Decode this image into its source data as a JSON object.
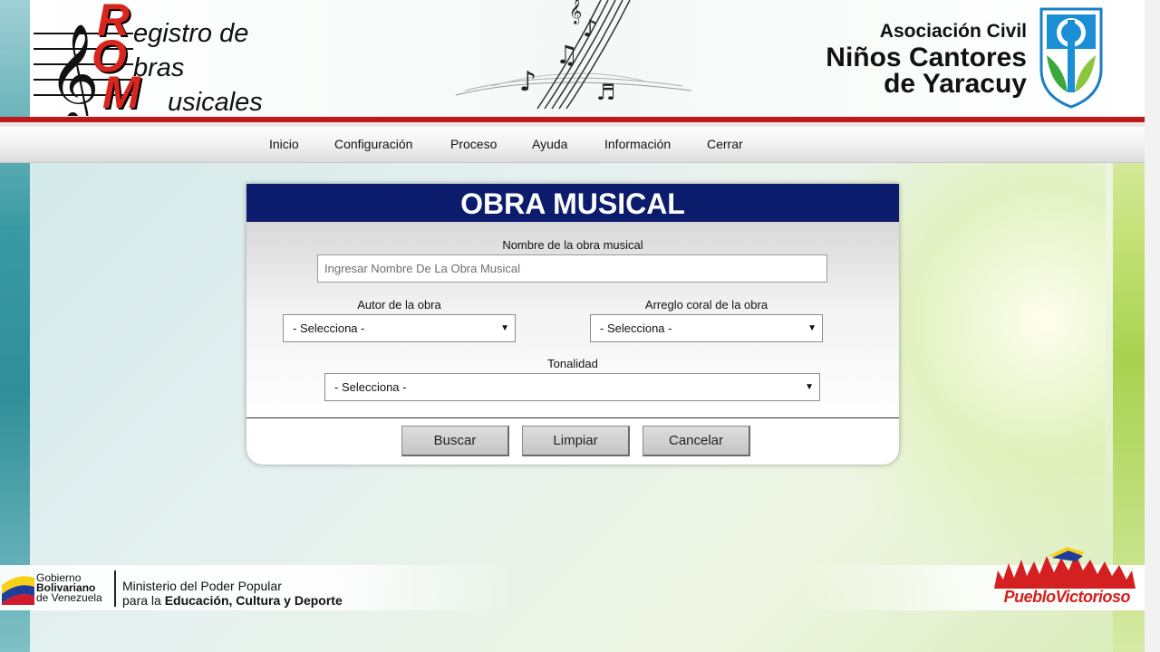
{
  "header": {
    "rom_letters": [
      "R",
      "O",
      "M"
    ],
    "rom_words": [
      "egistro de",
      "bras",
      "usicales"
    ],
    "assoc_line1": "Asociación Civil",
    "assoc_line2": "Niños Cantores",
    "assoc_line3": "de Yaracuy"
  },
  "nav": {
    "items": [
      "Inicio",
      "Configuración",
      "Proceso",
      "Ayuda",
      "Información",
      "Cerrar"
    ]
  },
  "form": {
    "title": "OBRA MUSICAL",
    "nombre_label": "Nombre de la obra musical",
    "nombre_placeholder": "Ingresar Nombre De La Obra Musical",
    "autor_label": "Autor de la obra",
    "autor_value": "- Selecciona -",
    "arreglo_label": "Arreglo coral de la obra",
    "arreglo_value": "- Selecciona -",
    "tonalidad_label": "Tonalidad",
    "tonalidad_value": "- Selecciona -",
    "buttons": {
      "buscar": "Buscar",
      "limpiar": "Limpiar",
      "cancelar": "Cancelar"
    }
  },
  "footer": {
    "gob_line1": "Gobierno",
    "gob_line2": "Bolivariano",
    "gob_line3": "de Venezuela",
    "min_line1": "Ministerio del Poder Popular",
    "min_line2_prefix": "para la ",
    "min_line2_bold": "Educación, Cultura y Deporte",
    "pueblo": "PuebloVictorioso"
  },
  "colors": {
    "title_bar": "#0b1c6c",
    "header_red": "#c0181b",
    "rom_red": "#d8261e"
  }
}
